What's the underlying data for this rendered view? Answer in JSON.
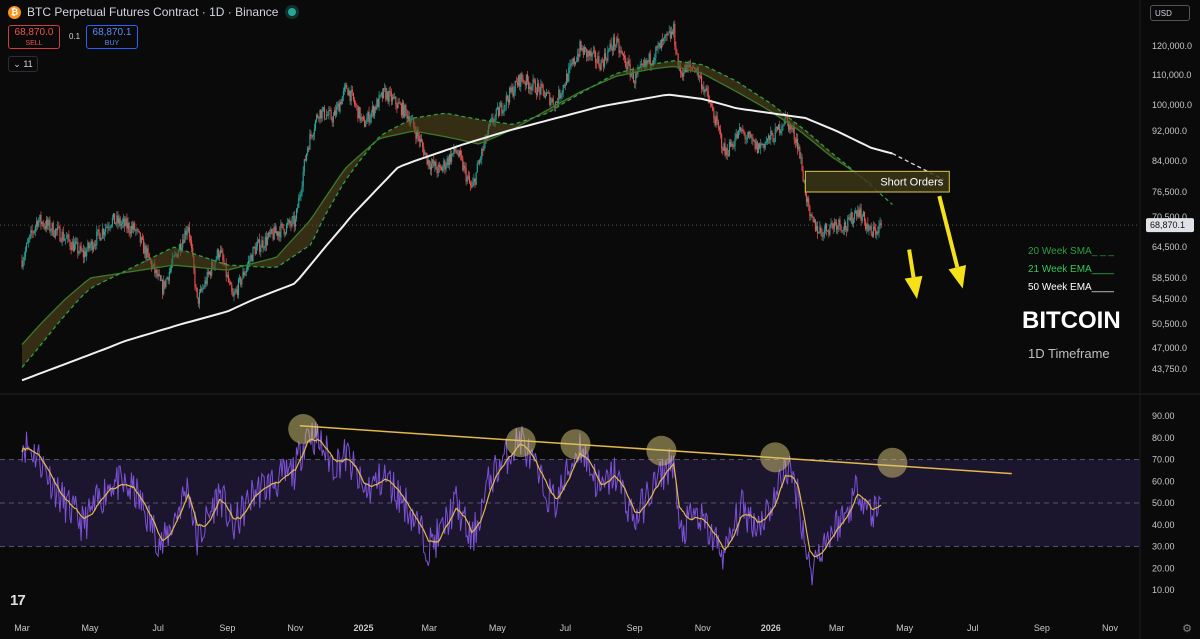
{
  "header": {
    "coin_glyph": "₿",
    "title": "BTC Perpetual Futures Contract · 1D · Binance"
  },
  "trade": {
    "sell_price": "68,870.0",
    "sell_label": "SELL",
    "spread": "0.1",
    "buy_price": "68,870.1",
    "buy_label": "BUY",
    "collapse_label": "⌄ 11"
  },
  "currency": "USD",
  "logo": "17",
  "colors": {
    "up": "#26a69a",
    "down": "#ef5350",
    "sma20": "#2e9e44",
    "ema21": "#3a7a2a",
    "ema50": "#f0f0f0",
    "annotation": "#f5e11a",
    "rsi": "#7b52d6",
    "rsi_ma": "#e2b94a"
  },
  "chart_data": [
    {
      "type": "line",
      "panel": "price",
      "ylim": [
        42500,
        125500
      ],
      "y_ticks": [
        120000.0,
        110000.0,
        100000.0,
        92000.0,
        84000.0,
        76500.0,
        70500.0,
        64500.0,
        58500.0,
        54500.0,
        50500.0,
        47000.0,
        43750.0
      ],
      "y_tick_labels": [
        "120,000.0",
        "110,000.0",
        "100,000.0",
        "92,000.0",
        "84,000.0",
        "76,500.0",
        "70,500.0",
        "64,500.0",
        "58,500.0",
        "54,500.0",
        "50,500.0",
        "47,000.0",
        "43,750.0"
      ],
      "current_price_label": "68,870.1",
      "price_anchors": {
        "dates": [
          "2024-03-01",
          "2024-03-15",
          "2024-04-05",
          "2024-04-25",
          "2024-05-20",
          "2024-06-10",
          "2024-07-05",
          "2024-07-28",
          "2024-08-05",
          "2024-08-25",
          "2024-09-06",
          "2024-09-25",
          "2024-10-15",
          "2024-11-01",
          "2024-11-12",
          "2024-11-22",
          "2024-12-05",
          "2024-12-17",
          "2025-01-01",
          "2025-01-20",
          "2025-02-10",
          "2025-02-28",
          "2025-03-10",
          "2025-03-25",
          "2025-04-08",
          "2025-04-25",
          "2025-05-22",
          "2025-06-10",
          "2025-06-22",
          "2025-07-14",
          "2025-08-02",
          "2025-08-14",
          "2025-09-01",
          "2025-09-18",
          "2025-10-06",
          "2025-10-11",
          "2025-10-25",
          "2025-11-05",
          "2025-11-21",
          "2025-12-05",
          "2025-12-20",
          "2026-01-05",
          "2026-01-14",
          "2026-01-25",
          "2026-02-05",
          "2026-02-15",
          "2026-03-01",
          "2026-03-10",
          "2026-03-20",
          "2026-04-01",
          "2026-04-10"
        ],
        "close": [
          62000,
          70000,
          67000,
          63000,
          70000,
          68000,
          56500,
          69000,
          54000,
          64000,
          54500,
          64000,
          67500,
          69500,
          88000,
          98000,
          96000,
          106000,
          94000,
          104000,
          97000,
          84000,
          81500,
          87000,
          77000,
          94000,
          109000,
          104500,
          100500,
          119000,
          114000,
          121500,
          108500,
          117000,
          125000,
          111000,
          113000,
          103000,
          86000,
          92000,
          87500,
          91000,
          96000,
          89000,
          70000,
          67500,
          69500,
          68500,
          72500,
          67000,
          68870
        ]
      },
      "sma20_week": {
        "name": "20 Week SMA_ _ _",
        "dates": [
          "2024-03-01",
          "2024-05-01",
          "2024-07-15",
          "2024-09-01",
          "2024-10-15",
          "2024-11-15",
          "2024-12-15",
          "2025-01-15",
          "2025-02-15",
          "2025-03-15",
          "2025-04-15",
          "2025-05-15",
          "2025-06-15",
          "2025-07-15",
          "2025-08-15",
          "2025-09-15",
          "2025-10-06",
          "2025-11-01",
          "2025-12-01",
          "2026-01-01",
          "2026-01-25",
          "2026-02-25",
          "2026-04-01",
          "2026-04-20"
        ],
        "values": [
          44000,
          56500,
          64500,
          61000,
          60500,
          65000,
          79000,
          90500,
          96000,
          97500,
          95500,
          94000,
          97500,
          104000,
          110500,
          113500,
          115000,
          113500,
          108000,
          100500,
          94000,
          86000,
          78000,
          73500
        ]
      },
      "ema21_week": {
        "name": "21 Week EMA____",
        "dates": [
          "2024-03-01",
          "2024-05-01",
          "2024-07-15",
          "2024-09-01",
          "2024-10-15",
          "2024-11-15",
          "2024-12-15",
          "2025-01-15",
          "2025-02-15",
          "2025-03-15",
          "2025-04-15",
          "2025-05-15",
          "2025-06-15",
          "2025-07-15",
          "2025-08-15",
          "2025-09-15",
          "2025-10-06",
          "2025-11-01",
          "2025-12-01",
          "2026-01-01",
          "2026-01-25",
          "2026-02-25",
          "2026-04-01",
          "2026-04-20"
        ],
        "values": [
          47500,
          58500,
          61000,
          60000,
          62500,
          70000,
          82000,
          90000,
          92000,
          90500,
          88500,
          92500,
          98500,
          104500,
          109500,
          112000,
          113000,
          110500,
          104500,
          98000,
          92500,
          85000,
          78500
        ]
      },
      "ema50_week": {
        "name": "50 Week EMA____",
        "dates": [
          "2024-03-01",
          "2024-06-01",
          "2024-09-01",
          "2024-11-01",
          "2024-12-15",
          "2025-02-01",
          "2025-04-01",
          "2025-06-01",
          "2025-08-01",
          "2025-10-01",
          "2025-11-01",
          "2025-12-01",
          "2026-01-01",
          "2026-02-01",
          "2026-03-01",
          "2026-04-01",
          "2026-04-20"
        ],
        "values": [
          42000,
          48000,
          52500,
          57500,
          69000,
          82500,
          88500,
          94000,
          99500,
          103500,
          102000,
          99000,
          97500,
          96000,
          92000,
          87500,
          86000
        ],
        "dashed_projection": {
          "dates": [
            "2026-04-20",
            "2026-06-05"
          ],
          "values": [
            86000,
            79500
          ]
        }
      },
      "annotations": [
        {
          "type": "zone",
          "label": "Short Orders",
          "date_start": "2026-02-01",
          "date_end": "2026-06-10",
          "y_low": 76500,
          "y_high": 81500
        },
        {
          "type": "arrow",
          "date_from": "2026-05-05",
          "from": 64000,
          "date_to": "2026-05-12",
          "to": 54500
        },
        {
          "type": "arrow",
          "date_from": "2026-06-01",
          "from": 75500,
          "date_to": "2026-06-22",
          "to": 56500
        }
      ],
      "legend": {
        "placement": "right",
        "entries": [
          "20 Week SMA_ _ _",
          "21 Week EMA____",
          "50 Week EMA____"
        ]
      },
      "title": "BITCOIN",
      "subtitle": "1D Timeframe"
    },
    {
      "type": "line",
      "panel": "rsi",
      "ylim": [
        5,
        93
      ],
      "y_ticks": [
        90,
        80,
        70,
        60,
        50,
        40,
        30,
        20,
        10
      ],
      "y_tick_labels": [
        "90.00",
        "80.00",
        "70.00",
        "60.00",
        "50.00",
        "40.00",
        "30.00",
        "20.00",
        "10.00"
      ],
      "band": [
        30,
        70
      ],
      "midline": 50,
      "rsi_anchors": {
        "dates": [
          "2024-03-01",
          "2024-03-15",
          "2024-04-05",
          "2024-04-25",
          "2024-05-20",
          "2024-06-10",
          "2024-07-05",
          "2024-07-28",
          "2024-08-05",
          "2024-08-25",
          "2024-09-06",
          "2024-09-25",
          "2024-10-15",
          "2024-11-01",
          "2024-11-12",
          "2024-11-22",
          "2024-12-05",
          "2024-12-17",
          "2025-01-01",
          "2025-01-20",
          "2025-02-10",
          "2025-02-28",
          "2025-03-10",
          "2025-03-25",
          "2025-04-08",
          "2025-04-25",
          "2025-05-22",
          "2025-06-10",
          "2025-06-22",
          "2025-07-14",
          "2025-08-02",
          "2025-08-14",
          "2025-09-01",
          "2025-09-18",
          "2025-10-06",
          "2025-10-11",
          "2025-10-25",
          "2025-11-05",
          "2025-11-21",
          "2025-12-05",
          "2025-12-20",
          "2026-01-05",
          "2026-01-14",
          "2026-01-25",
          "2026-02-05",
          "2026-02-15",
          "2026-03-01",
          "2026-03-10",
          "2026-03-20",
          "2026-04-01",
          "2026-04-10"
        ],
        "values": [
          78,
          72,
          52,
          40,
          60,
          55,
          30,
          58,
          32,
          55,
          38,
          55,
          60,
          65,
          84,
          78,
          68,
          72,
          55,
          62,
          48,
          30,
          35,
          50,
          32,
          62,
          80,
          58,
          50,
          77,
          55,
          64,
          42,
          58,
          70,
          35,
          45,
          38,
          26,
          48,
          40,
          52,
          68,
          55,
          18,
          30,
          40,
          45,
          58,
          45,
          50
        ]
      },
      "resistance_line": {
        "date_start": "2024-11-05",
        "start": 85.5,
        "date_end": "2026-08-05",
        "end": 63.5
      },
      "touch_points": {
        "dates": [
          "2024-11-08",
          "2025-05-22",
          "2025-07-10",
          "2025-09-25",
          "2026-01-05",
          "2026-04-20"
        ],
        "values": [
          84,
          78,
          77,
          74,
          71,
          68.5
        ]
      }
    }
  ],
  "x_axis": {
    "tick_dates": [
      "2024-03-01",
      "2024-05-01",
      "2024-07-01",
      "2024-09-01",
      "2024-11-01",
      "2025-01-01",
      "2025-03-01",
      "2025-05-01",
      "2025-07-01",
      "2025-09-01",
      "2025-11-01",
      "2026-01-01",
      "2026-03-01",
      "2026-05-01",
      "2026-07-01",
      "2026-09-01",
      "2026-11-01"
    ],
    "labels": [
      "Mar",
      "May",
      "Jul",
      "Sep",
      "Nov",
      "2025",
      "Mar",
      "May",
      "Jul",
      "Sep",
      "Nov",
      "2026",
      "Mar",
      "May",
      "Jul",
      "Sep",
      "Nov"
    ]
  }
}
